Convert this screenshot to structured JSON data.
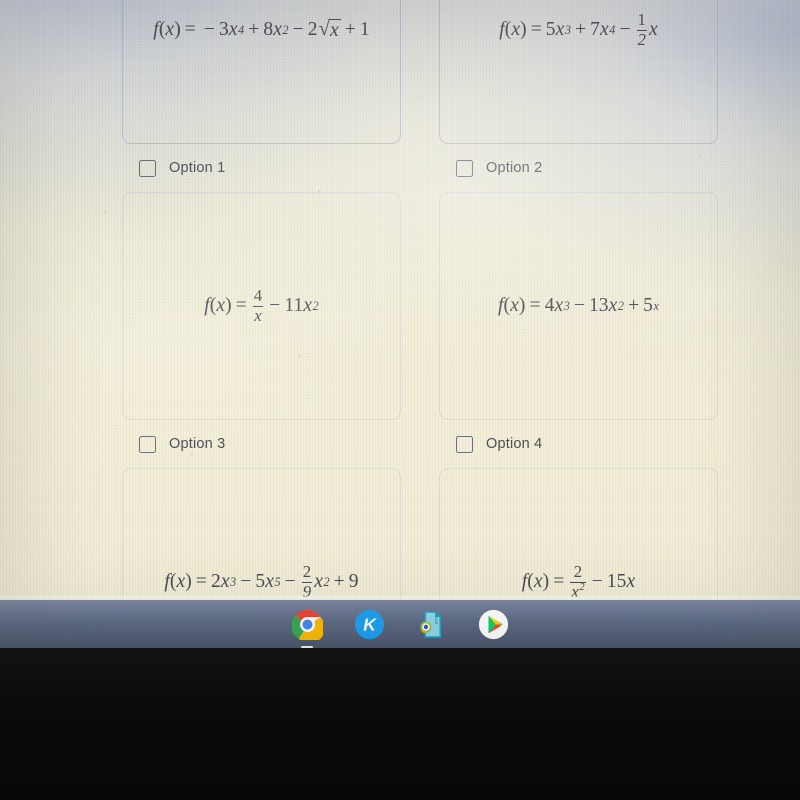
{
  "screen": {
    "device": "chromebook-screen-photo",
    "background_colors": {
      "paper": "#f1edd8",
      "cool_cast": "#c4cad6",
      "shelf": "#5d6c8c",
      "bezel": "#0a0a0a"
    }
  },
  "quiz": {
    "cards": [
      {
        "id": "card-1",
        "formula_text": "f(x) = - 3x^4 + 8x^2 - 2√x + 1",
        "has_option_row": true
      },
      {
        "id": "card-2",
        "formula_text": "f(x) = 5x^3 + 7x^4 - (1/2)x",
        "has_option_row": true
      },
      {
        "id": "card-3",
        "formula_text": "f(x) = 4/x - 11x^2",
        "has_option_row": true
      },
      {
        "id": "card-4",
        "formula_text": "f(x) = 4x^3 - 13x^2 + 5^x",
        "has_option_row": true
      },
      {
        "id": "card-5",
        "formula_text": "f(x) = 2x^3 - 5x^5 - (2/9)x^2 + 9",
        "has_option_row": false
      },
      {
        "id": "card-6",
        "formula_text": "f(x) = 2/x^2 - 15x",
        "has_option_row": false
      }
    ],
    "options": [
      {
        "label": "Option 1",
        "checked": false
      },
      {
        "label": "Option 2",
        "checked": false
      },
      {
        "label": "Option 3",
        "checked": false
      },
      {
        "label": "Option 4",
        "checked": false
      }
    ],
    "symbols": {
      "f": "f",
      "x": "x",
      "paren_open": "(",
      "paren_close": ")",
      "equals": "=",
      "plus": "+",
      "minus": "−",
      "radical": "√"
    },
    "terms": {
      "c1": {
        "coef3": "3",
        "exp4": "4",
        "coef8": "8",
        "exp2": "2",
        "coef2": "2",
        "const1": "1"
      },
      "c2": {
        "coef5": "5",
        "exp3": "3",
        "coef7": "7",
        "exp4": "4",
        "fnum": "1",
        "fden": "2"
      },
      "c3": {
        "fnum": "4",
        "fden": "x",
        "coef11": "11",
        "exp2": "2"
      },
      "c4": {
        "coef4": "4",
        "exp3": "3",
        "coef13": "13",
        "exp2": "2",
        "base5": "5",
        "expx": "x"
      },
      "c5": {
        "coef2": "2",
        "exp3": "3",
        "coef5": "5",
        "exp5": "5",
        "fnum": "2",
        "fden": "9",
        "exp2": "2",
        "const9": "9"
      },
      "c6": {
        "fnum": "2",
        "fden": "x",
        "fdenexp": "2",
        "coef15": "15"
      }
    }
  },
  "shelf": {
    "items": [
      {
        "name": "chrome",
        "label": "Google Chrome",
        "running": true
      },
      {
        "name": "kami",
        "label": "Kami",
        "running": false
      },
      {
        "name": "goat-doc",
        "label": "GOAT Document Viewer",
        "running": false
      },
      {
        "name": "play-store",
        "label": "Google Play Store",
        "running": false
      }
    ]
  }
}
